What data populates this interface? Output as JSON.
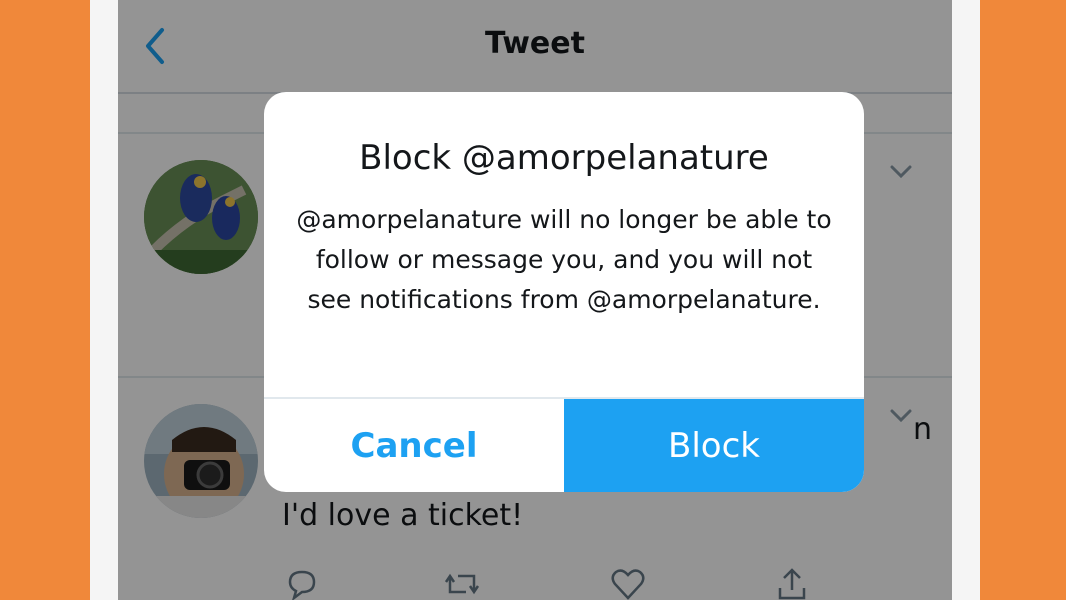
{
  "nav": {
    "title": "Tweet",
    "back_icon": "chevron-left-icon"
  },
  "tweets": [
    {
      "avatar": "parrots-avatar",
      "menu_icon": "chevron-down-icon"
    },
    {
      "avatar": "photographer-avatar",
      "menu_icon": "chevron-down-icon",
      "partial_text": "n",
      "text": "I'd love a ticket!",
      "actions": [
        "reply-icon",
        "retweet-icon",
        "like-icon",
        "share-icon"
      ]
    }
  ],
  "dialog": {
    "title": "Block @amorpelanature",
    "message": "@amorpelanature will no longer be able to follow or message you, and you will not see notifications from @amorpelanature.",
    "cancel_label": "Cancel",
    "block_label": "Block"
  },
  "colors": {
    "accent": "#1da1f2",
    "background": "#f0883a",
    "overlay": "rgba(0,0,0,0.42)"
  }
}
